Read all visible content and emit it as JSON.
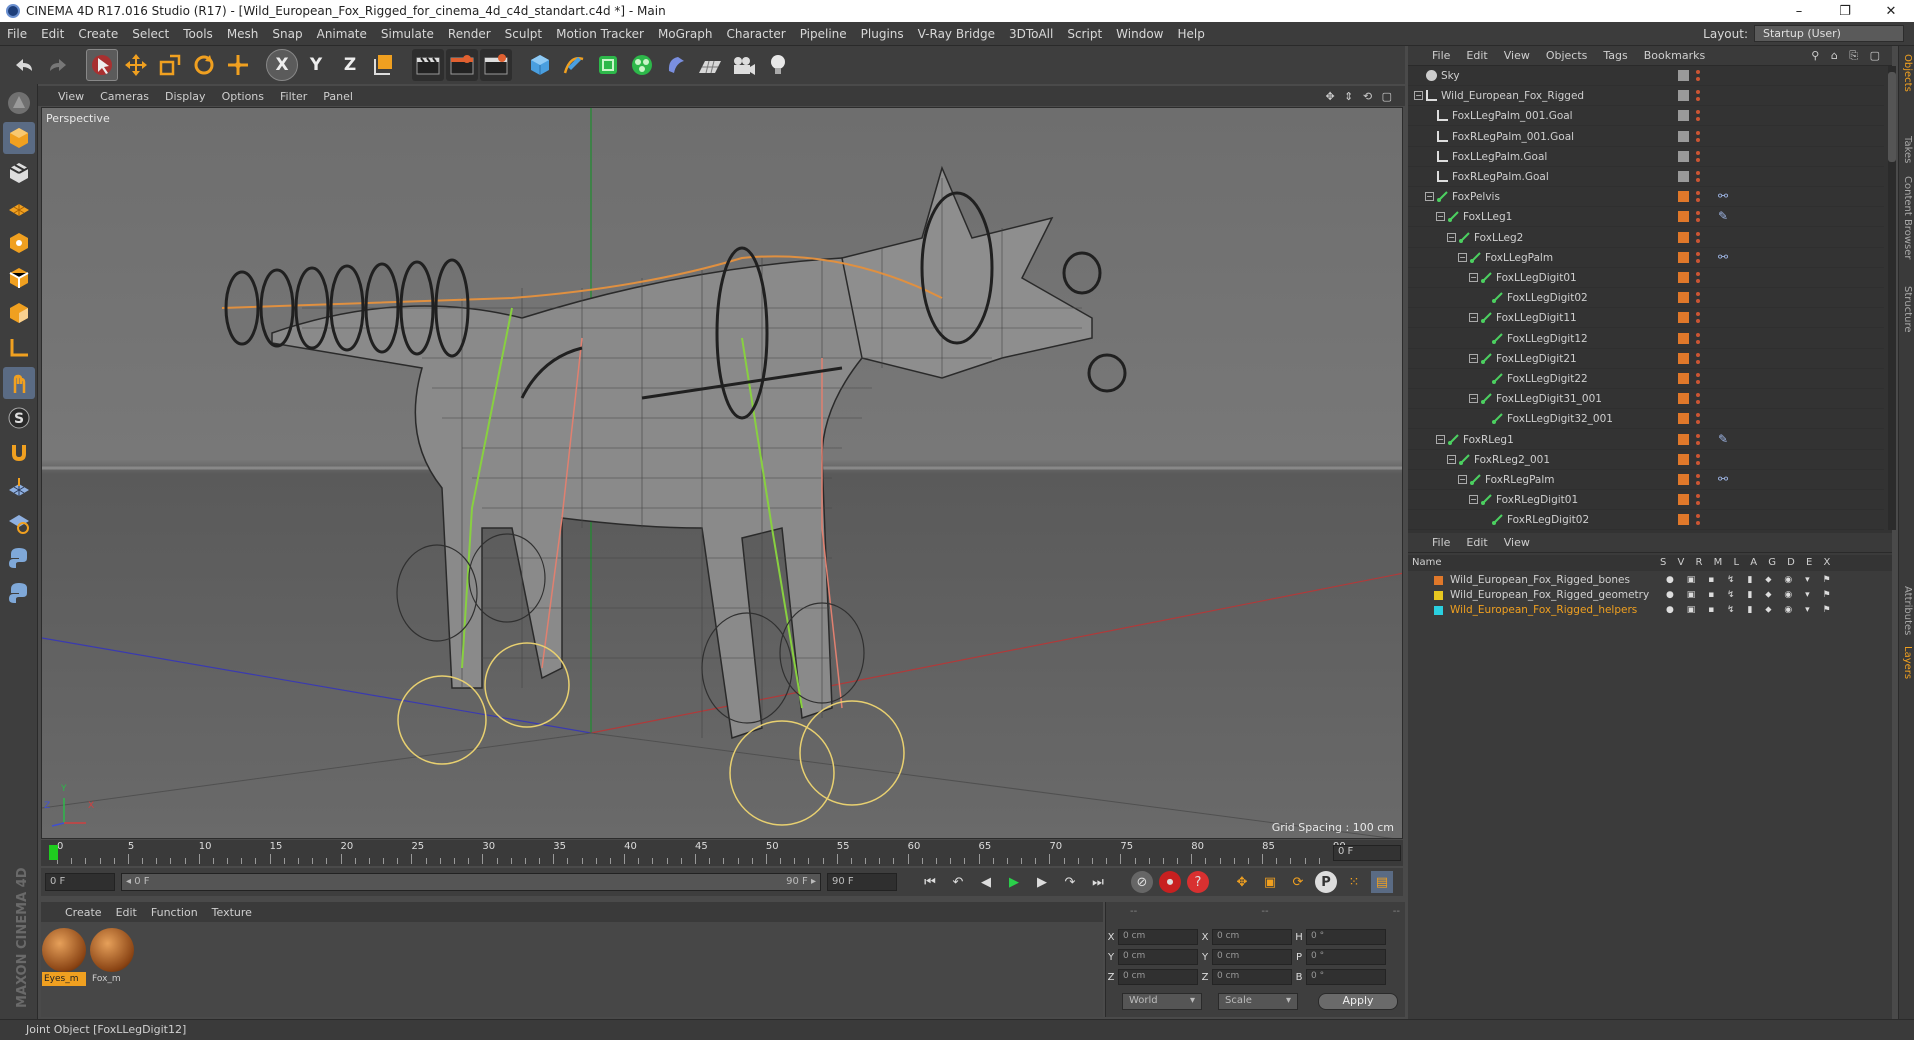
{
  "window": {
    "title": "CINEMA 4D R17.016 Studio (R17) - [Wild_European_Fox_Rigged_for_cinema_4d_c4d_standart.c4d *] - Main",
    "controls": [
      "–",
      "❐",
      "✕"
    ]
  },
  "menubar": {
    "items": [
      "File",
      "Edit",
      "Create",
      "Select",
      "Tools",
      "Mesh",
      "Snap",
      "Animate",
      "Simulate",
      "Render",
      "Sculpt",
      "Motion Tracker",
      "MoGraph",
      "Character",
      "Pipeline",
      "Plugins",
      "V-Ray Bridge",
      "3DToAll",
      "Script",
      "Window",
      "Help"
    ],
    "layout_label": "Layout:",
    "layout_value": "Startup (User)"
  },
  "toolbar": {
    "axis_x": "X",
    "axis_y": "Y",
    "axis_z": "Z"
  },
  "viewport": {
    "menu": [
      "View",
      "Cameras",
      "Display",
      "Options",
      "Filter",
      "Panel"
    ],
    "nav_icons": "✥ ⇕ ⟲ ▢",
    "label": "Perspective",
    "grid_spacing": "Grid Spacing : 100 cm",
    "axis_y": "Y",
    "axis_z": "Z",
    "axis_x": "X"
  },
  "timeline": {
    "ticks": [
      "0",
      "5",
      "10",
      "15",
      "20",
      "25",
      "30",
      "35",
      "40",
      "45",
      "50",
      "55",
      "60",
      "65",
      "70",
      "75",
      "80",
      "85",
      "90"
    ],
    "current_frame": "0 F"
  },
  "transport": {
    "start_field": "0 F",
    "range_start": "◂ 0 F",
    "range_end": "90 F ▸",
    "end_field": "90 F"
  },
  "materials": {
    "menu": [
      "Create",
      "Edit",
      "Function",
      "Texture"
    ],
    "items": [
      {
        "label": "Eyes_m",
        "selected": true
      },
      {
        "label": "Fox_m",
        "selected": false
      }
    ]
  },
  "coords": {
    "header": [
      "--",
      "--",
      "--"
    ],
    "rows": [
      {
        "a1": "X",
        "v1": "0 cm",
        "a2": "X",
        "v2": "0 cm",
        "a3": "H",
        "v3": "0 °"
      },
      {
        "a1": "Y",
        "v1": "0 cm",
        "a2": "Y",
        "v2": "0 cm",
        "a3": "P",
        "v3": "0 °"
      },
      {
        "a1": "Z",
        "v1": "0 cm",
        "a2": "Z",
        "v2": "0 cm",
        "a3": "B",
        "v3": "0 °"
      }
    ],
    "world": "World",
    "scale": "Scale",
    "apply": "Apply"
  },
  "brand": "MAXON CINEMA 4D",
  "status": "Joint Object [FoxLLegDigit12]",
  "object_manager": {
    "menu": [
      "File",
      "Edit",
      "View",
      "Objects",
      "Tags",
      "Bookmarks"
    ],
    "menu_icons": "⚲ ⌂ ⎘ ▢",
    "objects": [
      {
        "name": "Sky",
        "depth": 0,
        "expander": "",
        "icon": "sky",
        "tag": "gray"
      },
      {
        "name": "Wild_European_Fox_Rigged",
        "depth": 0,
        "expander": "−",
        "icon": "null",
        "tag": "gray"
      },
      {
        "name": "FoxLLegPalm_001.Goal",
        "depth": 1,
        "expander": "",
        "icon": "null",
        "tag": "gray"
      },
      {
        "name": "FoxRLegPalm_001.Goal",
        "depth": 1,
        "expander": "",
        "icon": "null",
        "tag": "gray"
      },
      {
        "name": "FoxLLegPalm.Goal",
        "depth": 1,
        "expander": "",
        "icon": "null",
        "tag": "gray"
      },
      {
        "name": "FoxRLegPalm.Goal",
        "depth": 1,
        "expander": "",
        "icon": "null",
        "tag": "gray"
      },
      {
        "name": "FoxPelvis",
        "depth": 1,
        "expander": "−",
        "icon": "joint",
        "tag": "orange",
        "ik": "⚯"
      },
      {
        "name": "FoxLLeg1",
        "depth": 2,
        "expander": "−",
        "icon": "joint",
        "tag": "orange",
        "ik": "✎"
      },
      {
        "name": "FoxLLeg2",
        "depth": 3,
        "expander": "−",
        "icon": "joint",
        "tag": "orange"
      },
      {
        "name": "FoxLLegPalm",
        "depth": 4,
        "expander": "−",
        "icon": "joint",
        "tag": "orange",
        "ik": "⚯"
      },
      {
        "name": "FoxLLegDigit01",
        "depth": 5,
        "expander": "−",
        "icon": "joint",
        "tag": "orange"
      },
      {
        "name": "FoxLLegDigit02",
        "depth": 6,
        "expander": "",
        "icon": "joint",
        "tag": "orange"
      },
      {
        "name": "FoxLLegDigit11",
        "depth": 5,
        "expander": "−",
        "icon": "joint",
        "tag": "orange"
      },
      {
        "name": "FoxLLegDigit12",
        "depth": 6,
        "expander": "",
        "icon": "joint",
        "tag": "orange"
      },
      {
        "name": "FoxLLegDigit21",
        "depth": 5,
        "expander": "−",
        "icon": "joint",
        "tag": "orange"
      },
      {
        "name": "FoxLLegDigit22",
        "depth": 6,
        "expander": "",
        "icon": "joint",
        "tag": "orange"
      },
      {
        "name": "FoxLLegDigit31_001",
        "depth": 5,
        "expander": "−",
        "icon": "joint",
        "tag": "orange"
      },
      {
        "name": "FoxLLegDigit32_001",
        "depth": 6,
        "expander": "",
        "icon": "joint",
        "tag": "orange"
      },
      {
        "name": "FoxRLeg1",
        "depth": 2,
        "expander": "−",
        "icon": "joint",
        "tag": "orange",
        "ik": "✎"
      },
      {
        "name": "FoxRLeg2_001",
        "depth": 3,
        "expander": "−",
        "icon": "joint",
        "tag": "orange"
      },
      {
        "name": "FoxRLegPalm",
        "depth": 4,
        "expander": "−",
        "icon": "joint",
        "tag": "orange",
        "ik": "⚯"
      },
      {
        "name": "FoxRLegDigit01",
        "depth": 5,
        "expander": "−",
        "icon": "joint",
        "tag": "orange"
      },
      {
        "name": "FoxRLegDigit02",
        "depth": 6,
        "expander": "",
        "icon": "joint",
        "tag": "orange"
      }
    ]
  },
  "layer_manager": {
    "menu": [
      "File",
      "Edit",
      "View"
    ],
    "columns": {
      "name": "Name",
      "flags": "S V R M L A G D E X"
    },
    "layers": [
      {
        "name": "Wild_European_Fox_Rigged_bones",
        "color": "#e0782a",
        "highlight": false
      },
      {
        "name": "Wild_European_Fox_Rigged_geometry",
        "color": "#e8c820",
        "highlight": false
      },
      {
        "name": "Wild_European_Fox_Rigged_helpers",
        "color": "#2ad0e0",
        "highlight": true
      }
    ],
    "layer_flags": "● ▣ ▪ ↯ ▮ ⬥ ◉ ▾ ⚑"
  },
  "side_tabs": [
    "Objects",
    "Takes",
    "Content Browser",
    "Structure",
    "Attributes",
    "Layers"
  ],
  "colors": {
    "accent": "#f0a020",
    "selection": "#5a6b84",
    "panel": "#3e3e3e"
  }
}
